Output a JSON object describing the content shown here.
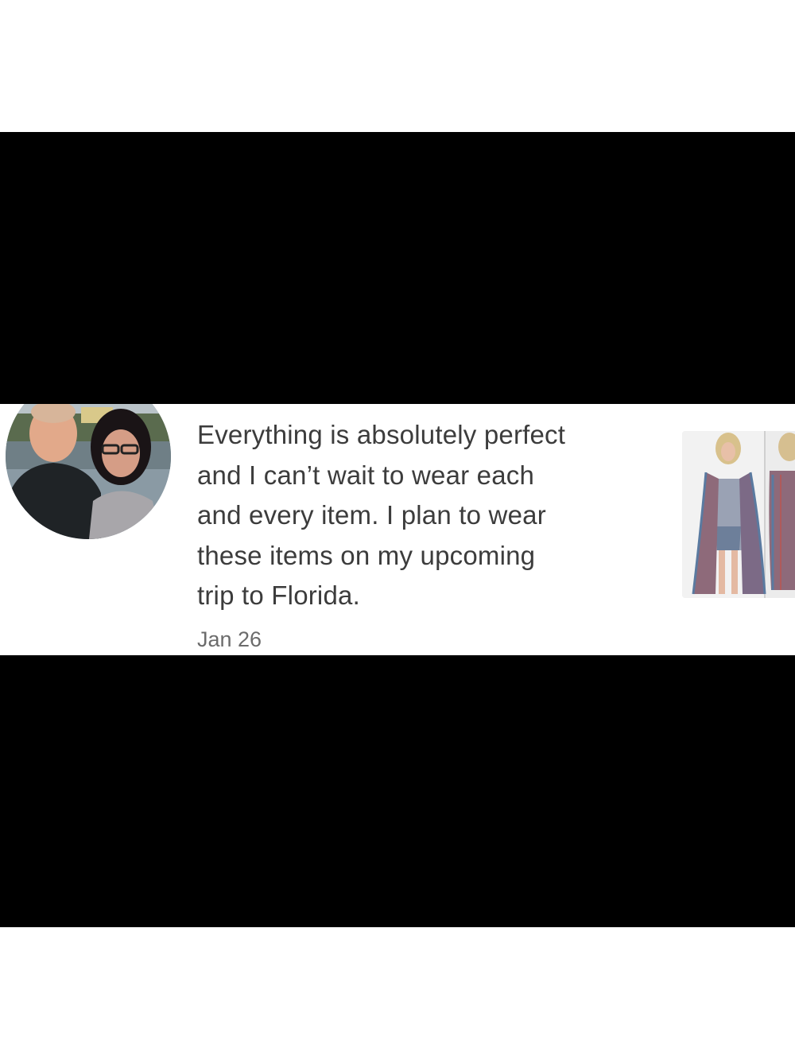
{
  "review": {
    "text": "Everything is absolutely perfect\nand I can’t wait to wear each\nand every item. I plan to wear\nthese items on my upcoming\ntrip to Florida.",
    "date": "Jan 26",
    "avatar_icon": "reviewer-avatar-photo",
    "product_icon": "product-photo-striped-cardigan"
  },
  "colors": {
    "background": "#ffffff",
    "mask": "#000000",
    "text": "#3c3c3c",
    "date": "#6b6b6b"
  }
}
